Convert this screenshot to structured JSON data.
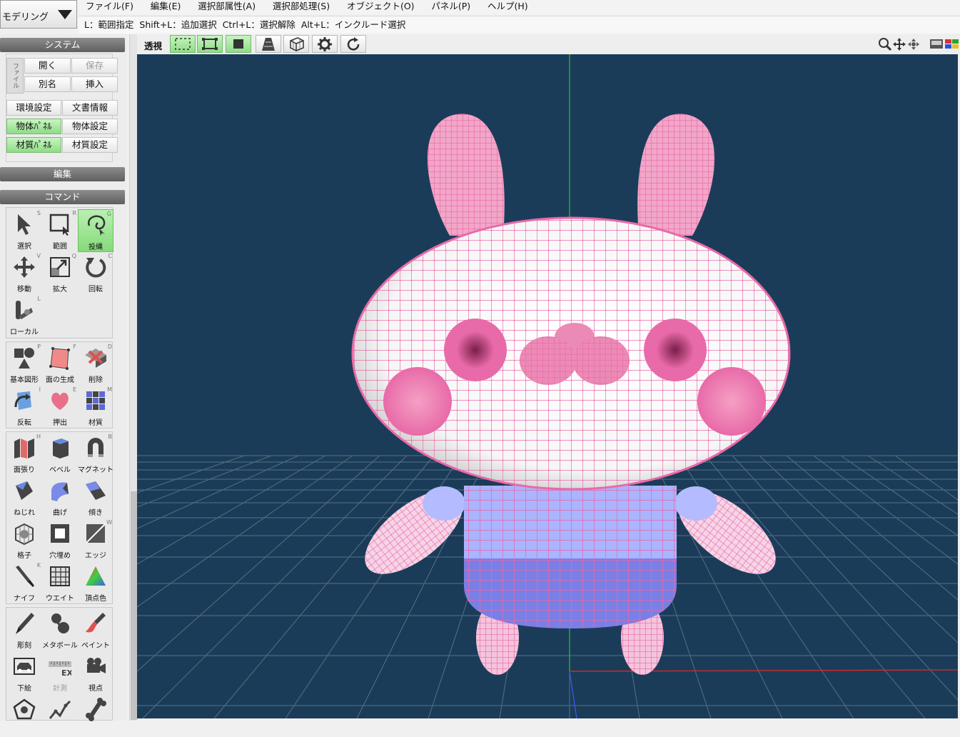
{
  "mode": {
    "label": "モデリング"
  },
  "menu": [
    "ファイル(F)",
    "編集(E)",
    "選択部属性(A)",
    "選択部処理(S)",
    "オブジェクト(O)",
    "パネル(P)",
    "ヘルプ(H)"
  ],
  "hint": "L：範囲指定  Shift+L：追加選択  Ctrl+L：選択解除  Alt+L：インクルード選択",
  "system": {
    "header": "システム",
    "file_tab": "ファイル",
    "open": "開く",
    "save": "保存",
    "save_as": "別名",
    "insert": "挿入",
    "env": "環境設定",
    "doc_info": "文書情報",
    "object_panel": "物体ﾊﾟﾈﾙ",
    "object_settings": "物体設定",
    "material_panel": "材質ﾊﾟﾈﾙ",
    "material_settings": "材質設定"
  },
  "edit_header": "編集",
  "command_header": "コマンド",
  "tools": {
    "select": {
      "label": "選択",
      "key": "S"
    },
    "range": {
      "label": "範囲",
      "key": "R"
    },
    "lasso": {
      "label": "投縄",
      "key": "G"
    },
    "move": {
      "label": "移動",
      "key": "V"
    },
    "scale": {
      "label": "拡大",
      "key": "Q"
    },
    "rotate": {
      "label": "回転",
      "key": "C"
    },
    "local": {
      "label": "ローカル",
      "key": "L"
    },
    "primitive": {
      "label": "基本図形",
      "key": "P"
    },
    "face_gen": {
      "label": "面の生成",
      "key": "F"
    },
    "delete": {
      "label": "削除",
      "key": "D"
    },
    "flip": {
      "label": "反転",
      "key": "I"
    },
    "extrude": {
      "label": "押出",
      "key": "E"
    },
    "material": {
      "label": "材質",
      "key": "M"
    },
    "face_paste": {
      "label": "面張り",
      "key": "H"
    },
    "bevel": {
      "label": "ベベル",
      "key": ""
    },
    "magnet": {
      "label": "マグネット",
      "key": "B"
    },
    "twist": {
      "label": "ねじれ",
      "key": ""
    },
    "bend": {
      "label": "曲げ",
      "key": ""
    },
    "tilt": {
      "label": "傾き",
      "key": ""
    },
    "lattice": {
      "label": "格子",
      "key": ""
    },
    "hole_fill": {
      "label": "穴埋め",
      "key": ""
    },
    "edge": {
      "label": "エッジ",
      "key": "W"
    },
    "knife": {
      "label": "ナイフ",
      "key": "K"
    },
    "weight": {
      "label": "ウエイト",
      "key": ""
    },
    "vertex_color": {
      "label": "頂点色",
      "key": ""
    },
    "sculpt": {
      "label": "彫刻",
      "key": ""
    },
    "metaball": {
      "label": "メタボール",
      "key": ""
    },
    "paint": {
      "label": "ペイント",
      "key": ""
    },
    "underlay": {
      "label": "下絵",
      "key": ""
    },
    "measure": {
      "label": "計測",
      "key": ""
    },
    "viewpoint": {
      "label": "視点",
      "key": ""
    }
  },
  "view": {
    "persp_label": "透視"
  },
  "colors": {
    "viewport_bg": "#1b3c59",
    "wire": "#e86aa8",
    "select_green": "#8fdc86",
    "shirt_light": "#aab4ff",
    "shirt_dark": "#7a7fe6"
  }
}
